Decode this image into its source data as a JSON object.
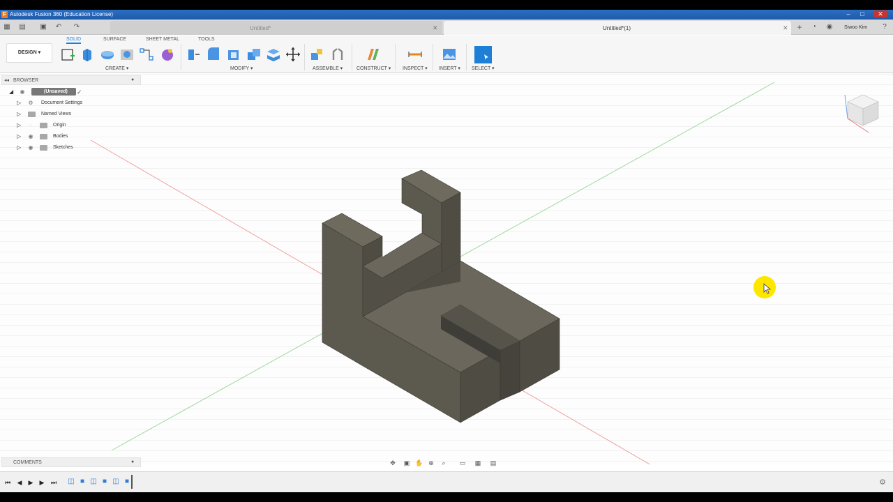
{
  "window": {
    "title": "Autodesk Fusion 360 (Education License)",
    "logo_letter": "F",
    "min": "–",
    "max": "□",
    "close": "✕"
  },
  "tabs": {
    "inactive_label": "Untitled*",
    "active_label": "Untitled*(1)",
    "close_glyph": "✕",
    "add_glyph": "+",
    "user": "Siwoo Kim"
  },
  "ribbon": {
    "mode": "DESIGN ▾",
    "tabs": [
      "SOLID",
      "SURFACE",
      "SHEET METAL",
      "TOOLS"
    ],
    "groups": [
      "CREATE ▾",
      "MODIFY ▾",
      "ASSEMBLE ▾",
      "CONSTRUCT ▾",
      "INSPECT ▾",
      "INSERT ▾",
      "SELECT ▾"
    ]
  },
  "browser": {
    "title": "BROWSER",
    "root": "(Unsaved)",
    "items": [
      "Document Settings",
      "Named Views",
      "Origin",
      "Bodies",
      "Sketches"
    ]
  },
  "comments": {
    "title": "COMMENTS"
  },
  "colors": {
    "accent": "#1d7fd6",
    "body_face_top": "#6e6a5e",
    "body_face_left": "#5a574d",
    "body_face_right": "#4e4b43",
    "cursor_highlight": "#ffe600"
  },
  "icons": {
    "apps": "apps-grid-icon",
    "file": "file-icon",
    "save": "save-icon",
    "undo": "undo-icon",
    "redo": "redo-icon",
    "settings": "gear-icon"
  }
}
